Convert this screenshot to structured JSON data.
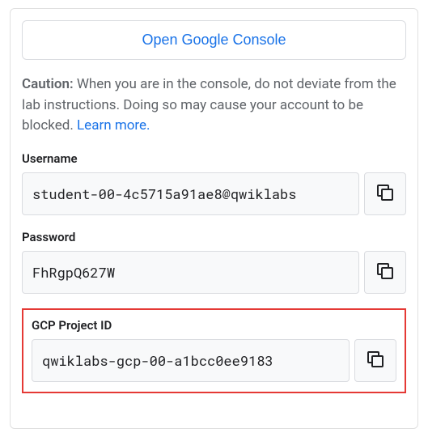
{
  "console_button_label": "Open Google Console",
  "caution": {
    "label": "Caution:",
    "text": " When you are in the console, do not deviate from the lab instructions. Doing so may cause your account to be blocked. ",
    "learn_more": "Learn more."
  },
  "fields": {
    "username": {
      "label": "Username",
      "value": "student-00-4c5715a91ae8@qwiklabs"
    },
    "password": {
      "label": "Password",
      "value": "FhRgpQ627W"
    },
    "project_id": {
      "label": "GCP Project ID",
      "value": "qwiklabs-gcp-00-a1bcc0ee9183"
    }
  }
}
